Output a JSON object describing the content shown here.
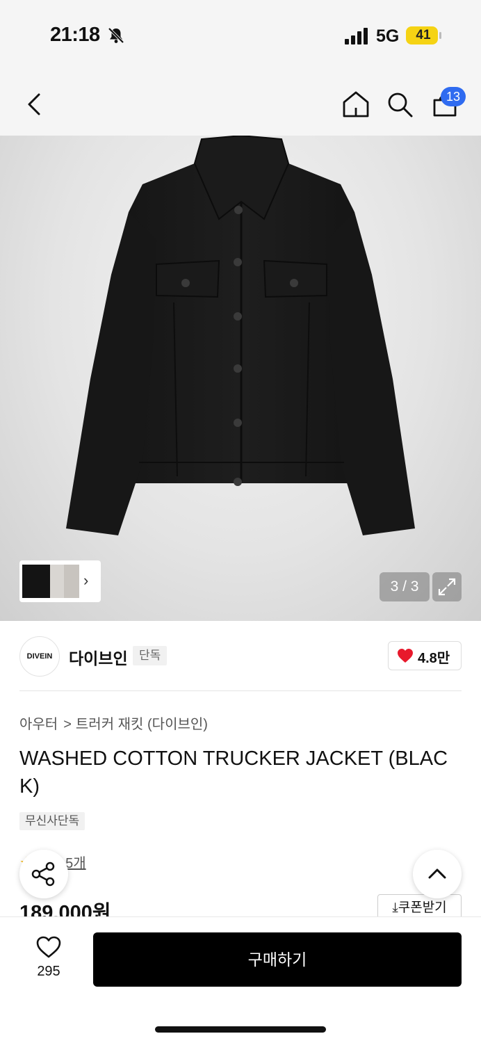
{
  "status_bar": {
    "time": "21:18",
    "network": "5G",
    "battery": "41",
    "battery_color": "#f5d314"
  },
  "header": {
    "cart_count": "13",
    "badge_color": "#2f6bf0"
  },
  "gallery": {
    "page_counter": "3 / 3"
  },
  "brand": {
    "logo_text": "DIVEIN",
    "name": "다이브인",
    "tag": "단독",
    "likes": "4.8만",
    "heart_color": "#e8192c"
  },
  "product": {
    "breadcrumb": [
      "아우터",
      "트러커 재킷 (다이브인)"
    ],
    "breadcrumb_sep": ">",
    "title": "WASHED COTTON TRUCKER JACKET (BLACK)",
    "exclusive_tag": "무신사단독",
    "review_text": "후기 5개",
    "price": "189,000원",
    "coupon_label": "쿠폰받기"
  },
  "bottom_bar": {
    "wish_count": "295",
    "buy_label": "구매하기"
  }
}
